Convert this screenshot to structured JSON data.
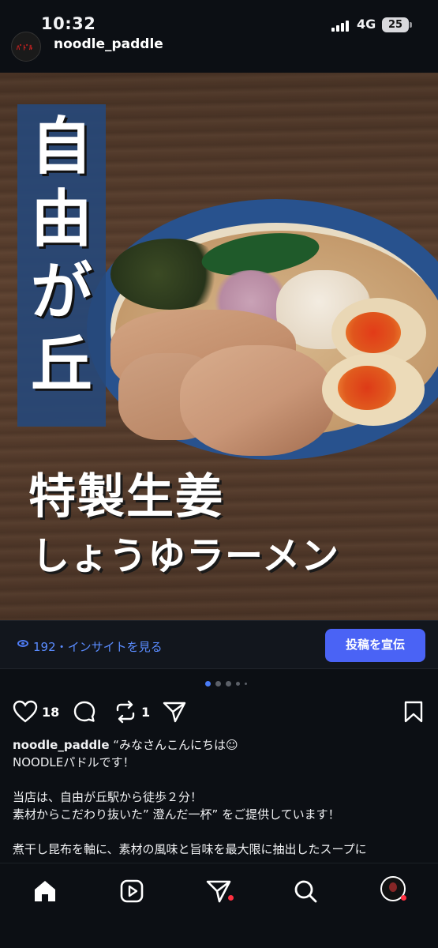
{
  "status_bar": {
    "time": "10:32",
    "network": "4G",
    "battery": "25"
  },
  "post_header": {
    "username": "noodle_paddle"
  },
  "post_image": {
    "vertical_text": "自由が丘",
    "headline_1": "特製生姜",
    "headline_2": "しょうゆラーメン"
  },
  "insights": {
    "views": "192",
    "link_text": "192・インサイトを見る",
    "promote_label": "投稿を宣伝"
  },
  "carousel": {
    "total": 5,
    "active": 1
  },
  "actions": {
    "likes": "18",
    "reposts": "1"
  },
  "caption": {
    "username": "noodle_paddle",
    "lines": [
      "“みなさんこんにちは☺",
      "NOODLEパドルです！",
      "",
      "当店は、自由が丘駅から徒歩２分！",
      "素材からこだわり抜いた” 澄んだ一杯” をご提供しています！",
      "",
      "煮干し昆布を軸に、素材の風味と旨味を最大限に抽出したスープに"
    ]
  },
  "colors": {
    "background": "#0c0f14",
    "accent": "#4a63f5",
    "link": "#5a8cff",
    "notification": "#ff3040"
  }
}
